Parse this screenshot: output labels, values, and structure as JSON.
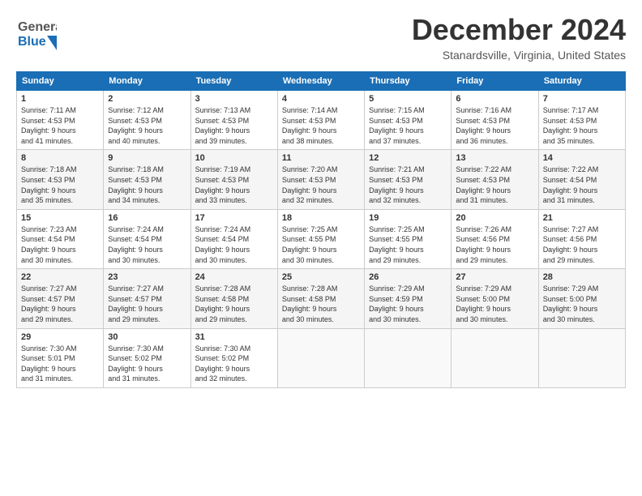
{
  "header": {
    "month_title": "December 2024",
    "location": "Stanardsville, Virginia, United States",
    "logo_general": "General",
    "logo_blue": "Blue"
  },
  "weekdays": [
    "Sunday",
    "Monday",
    "Tuesday",
    "Wednesday",
    "Thursday",
    "Friday",
    "Saturday"
  ],
  "weeks": [
    [
      {
        "day": "1",
        "sunrise": "7:11 AM",
        "sunset": "4:53 PM",
        "daylight": "9 hours and 41 minutes."
      },
      {
        "day": "2",
        "sunrise": "7:12 AM",
        "sunset": "4:53 PM",
        "daylight": "9 hours and 40 minutes."
      },
      {
        "day": "3",
        "sunrise": "7:13 AM",
        "sunset": "4:53 PM",
        "daylight": "9 hours and 39 minutes."
      },
      {
        "day": "4",
        "sunrise": "7:14 AM",
        "sunset": "4:53 PM",
        "daylight": "9 hours and 38 minutes."
      },
      {
        "day": "5",
        "sunrise": "7:15 AM",
        "sunset": "4:53 PM",
        "daylight": "9 hours and 37 minutes."
      },
      {
        "day": "6",
        "sunrise": "7:16 AM",
        "sunset": "4:53 PM",
        "daylight": "9 hours and 36 minutes."
      },
      {
        "day": "7",
        "sunrise": "7:17 AM",
        "sunset": "4:53 PM",
        "daylight": "9 hours and 35 minutes."
      }
    ],
    [
      {
        "day": "8",
        "sunrise": "7:18 AM",
        "sunset": "4:53 PM",
        "daylight": "9 hours and 35 minutes."
      },
      {
        "day": "9",
        "sunrise": "7:18 AM",
        "sunset": "4:53 PM",
        "daylight": "9 hours and 34 minutes."
      },
      {
        "day": "10",
        "sunrise": "7:19 AM",
        "sunset": "4:53 PM",
        "daylight": "9 hours and 33 minutes."
      },
      {
        "day": "11",
        "sunrise": "7:20 AM",
        "sunset": "4:53 PM",
        "daylight": "9 hours and 32 minutes."
      },
      {
        "day": "12",
        "sunrise": "7:21 AM",
        "sunset": "4:53 PM",
        "daylight": "9 hours and 32 minutes."
      },
      {
        "day": "13",
        "sunrise": "7:22 AM",
        "sunset": "4:53 PM",
        "daylight": "9 hours and 31 minutes."
      },
      {
        "day": "14",
        "sunrise": "7:22 AM",
        "sunset": "4:54 PM",
        "daylight": "9 hours and 31 minutes."
      }
    ],
    [
      {
        "day": "15",
        "sunrise": "7:23 AM",
        "sunset": "4:54 PM",
        "daylight": "9 hours and 30 minutes."
      },
      {
        "day": "16",
        "sunrise": "7:24 AM",
        "sunset": "4:54 PM",
        "daylight": "9 hours and 30 minutes."
      },
      {
        "day": "17",
        "sunrise": "7:24 AM",
        "sunset": "4:54 PM",
        "daylight": "9 hours and 30 minutes."
      },
      {
        "day": "18",
        "sunrise": "7:25 AM",
        "sunset": "4:55 PM",
        "daylight": "9 hours and 30 minutes."
      },
      {
        "day": "19",
        "sunrise": "7:25 AM",
        "sunset": "4:55 PM",
        "daylight": "9 hours and 29 minutes."
      },
      {
        "day": "20",
        "sunrise": "7:26 AM",
        "sunset": "4:56 PM",
        "daylight": "9 hours and 29 minutes."
      },
      {
        "day": "21",
        "sunrise": "7:27 AM",
        "sunset": "4:56 PM",
        "daylight": "9 hours and 29 minutes."
      }
    ],
    [
      {
        "day": "22",
        "sunrise": "7:27 AM",
        "sunset": "4:57 PM",
        "daylight": "9 hours and 29 minutes."
      },
      {
        "day": "23",
        "sunrise": "7:27 AM",
        "sunset": "4:57 PM",
        "daylight": "9 hours and 29 minutes."
      },
      {
        "day": "24",
        "sunrise": "7:28 AM",
        "sunset": "4:58 PM",
        "daylight": "9 hours and 29 minutes."
      },
      {
        "day": "25",
        "sunrise": "7:28 AM",
        "sunset": "4:58 PM",
        "daylight": "9 hours and 30 minutes."
      },
      {
        "day": "26",
        "sunrise": "7:29 AM",
        "sunset": "4:59 PM",
        "daylight": "9 hours and 30 minutes."
      },
      {
        "day": "27",
        "sunrise": "7:29 AM",
        "sunset": "5:00 PM",
        "daylight": "9 hours and 30 minutes."
      },
      {
        "day": "28",
        "sunrise": "7:29 AM",
        "sunset": "5:00 PM",
        "daylight": "9 hours and 30 minutes."
      }
    ],
    [
      {
        "day": "29",
        "sunrise": "7:30 AM",
        "sunset": "5:01 PM",
        "daylight": "9 hours and 31 minutes."
      },
      {
        "day": "30",
        "sunrise": "7:30 AM",
        "sunset": "5:02 PM",
        "daylight": "9 hours and 31 minutes."
      },
      {
        "day": "31",
        "sunrise": "7:30 AM",
        "sunset": "5:02 PM",
        "daylight": "9 hours and 32 minutes."
      },
      null,
      null,
      null,
      null
    ]
  ],
  "labels": {
    "sunrise": "Sunrise:",
    "sunset": "Sunset:",
    "daylight": "Daylight:"
  }
}
